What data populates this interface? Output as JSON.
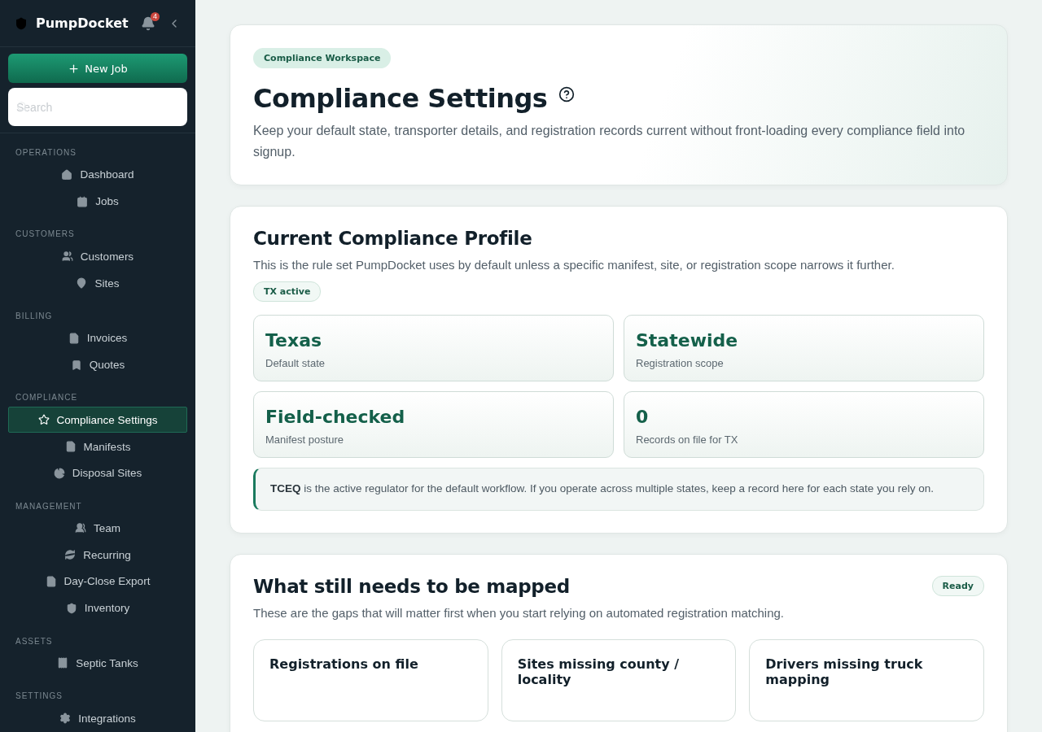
{
  "sidebar": {
    "brand": "PumpDocket",
    "notification_count": "4",
    "new_job_button": "New Job",
    "search": {
      "placeholder": "Search"
    },
    "sections": [
      {
        "title": "OPERATIONS",
        "items": [
          {
            "label": "Dashboard",
            "selected": false
          },
          {
            "label": "Jobs",
            "selected": false
          }
        ]
      },
      {
        "title": "CUSTOMERS",
        "items": [
          {
            "label": "Customers",
            "selected": false
          },
          {
            "label": "Sites",
            "selected": false
          }
        ]
      },
      {
        "title": "BILLING",
        "items": [
          {
            "label": "Invoices",
            "selected": false
          },
          {
            "label": "Quotes",
            "selected": false
          }
        ]
      },
      {
        "title": "COMPLIANCE",
        "items": [
          {
            "label": "Compliance Settings",
            "selected": true
          },
          {
            "label": "Manifests",
            "selected": false
          },
          {
            "label": "Disposal Sites",
            "selected": false
          }
        ]
      },
      {
        "title": "MANAGEMENT",
        "items": [
          {
            "label": "Team",
            "selected": false
          },
          {
            "label": "Recurring",
            "selected": false
          },
          {
            "label": "Day-Close Export",
            "selected": false
          },
          {
            "label": "Inventory",
            "selected": false
          }
        ]
      },
      {
        "title": "ASSETS",
        "items": [
          {
            "label": "Septic Tanks",
            "selected": false
          }
        ]
      },
      {
        "title": "SETTINGS",
        "items": [
          {
            "label": "Integrations",
            "selected": false
          }
        ]
      }
    ]
  },
  "header": {
    "badge": "Compliance Workspace",
    "title": "Compliance Settings",
    "description": "Keep your default state, transporter details, and registration records current without front-loading every compliance field into signup."
  },
  "profile": {
    "title": "Current Compliance Profile",
    "description": "This is the rule set PumpDocket uses by default unless a specific manifest, site, or registration scope narrows it further.",
    "badge": "TX active",
    "stats": [
      {
        "value": "Texas",
        "label": "Default state"
      },
      {
        "value": "Statewide",
        "label": "Registration scope"
      },
      {
        "value": "Field-checked",
        "label": "Manifest posture"
      },
      {
        "value": "0",
        "label": "Records on file for TX"
      }
    ],
    "note": "**TCEQ** is the active regulator for the default workflow. If you operate across multiple states, keep a record here for each state you rely on."
  },
  "mapping": {
    "title": "What still needs to be mapped",
    "description": "These are the gaps that will matter first when you start relying on automated registration matching.",
    "status": "Ready",
    "gaps": [
      {
        "title": "Registrations on file"
      },
      {
        "title": "Sites missing county / locality"
      },
      {
        "title": "Drivers missing truck mapping"
      }
    ]
  }
}
